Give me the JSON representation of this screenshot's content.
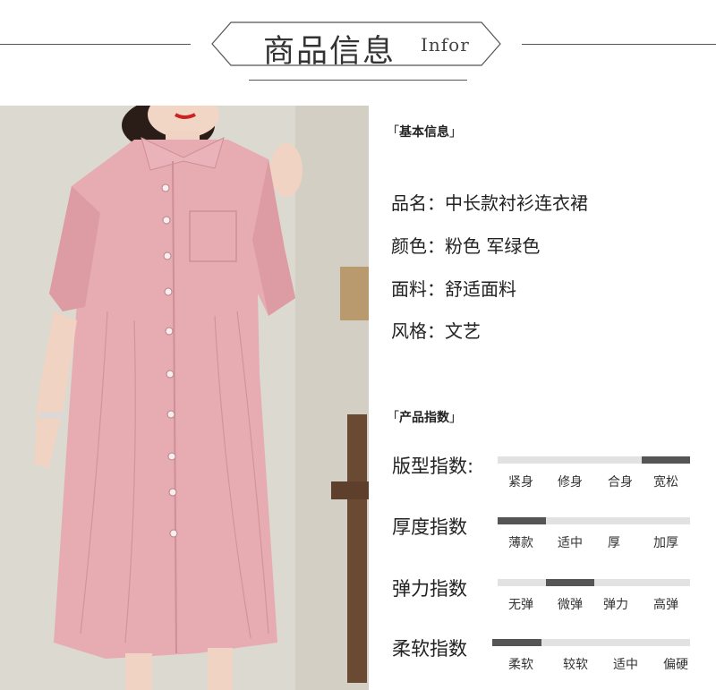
{
  "header": {
    "title": "商品信息",
    "subtitle": "Infor"
  },
  "basic_info": {
    "section_title": "基本信息",
    "bracket_open": "「",
    "bracket_close": "」",
    "rows": [
      "品名：中长款衬衫连衣裙",
      "颜色：粉色  军绿色",
      "面料：舒适面料",
      "风格：文艺"
    ]
  },
  "product_index": {
    "section_title": "产品指数",
    "indexes": [
      {
        "label": "版型指数:",
        "levels": [
          "紧身",
          "修身",
          "合身",
          "宽松"
        ],
        "selected": 3
      },
      {
        "label": "厚度指数",
        "levels": [
          "薄款",
          "适中",
          "厚",
          "加厚"
        ],
        "selected": 0
      },
      {
        "label": "弹力指数",
        "levels": [
          "无弹",
          "微弹",
          "弹力",
          "高弹"
        ],
        "selected": 1
      },
      {
        "label": "柔软指数",
        "levels": [
          "柔软",
          "较软",
          "适中",
          "偏硬"
        ],
        "selected": 0
      }
    ]
  },
  "colors": {
    "dress": "#e6a9b0",
    "bar_track": "#e2e2e2",
    "bar_fill": "#555555"
  }
}
